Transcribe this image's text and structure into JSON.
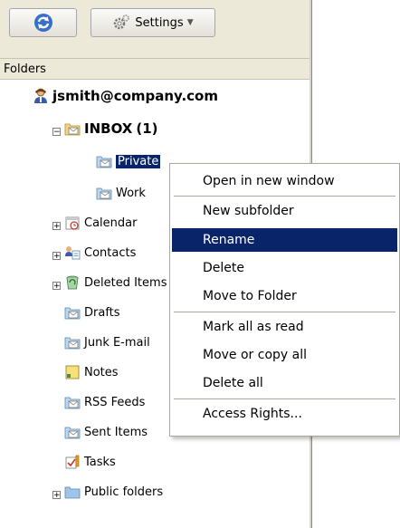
{
  "toolbar": {
    "refresh_icon": "refresh-icon",
    "settings_icon": "gear-icon",
    "settings_label": "Settings"
  },
  "folders_header": "Folders",
  "tree": {
    "account": "jsmith@company.com",
    "inbox_label": "INBOX",
    "inbox_count": "(1)",
    "items": [
      {
        "label": "Private",
        "icon": "mail-folder-icon"
      },
      {
        "label": "Work",
        "icon": "mail-folder-icon"
      },
      {
        "label": "Calendar",
        "icon": "calendar-icon"
      },
      {
        "label": "Contacts",
        "icon": "contacts-icon"
      },
      {
        "label": "Deleted Items",
        "icon": "trash-icon"
      },
      {
        "label": "Drafts",
        "icon": "mail-folder-icon"
      },
      {
        "label": "Junk E-mail",
        "icon": "mail-folder-icon"
      },
      {
        "label": "Notes",
        "icon": "notes-icon"
      },
      {
        "label": "RSS Feeds",
        "icon": "mail-folder-icon"
      },
      {
        "label": "Sent Items",
        "icon": "mail-folder-icon"
      },
      {
        "label": "Tasks",
        "icon": "tasks-icon"
      },
      {
        "label": "Public folders",
        "icon": "folder-icon"
      }
    ]
  },
  "context_menu": {
    "items": [
      "Open in new window",
      "New subfolder",
      "Rename",
      "Delete",
      "Move to Folder",
      "Mark all as read",
      "Move or copy all",
      "Delete all",
      "Access Rights..."
    ],
    "highlighted": "Rename"
  },
  "colors": {
    "selection": "#0a246a",
    "toolbar_bg": "#ece9d8",
    "folder_blue": "#9fc6e8",
    "folder_yellow": "#f5d77a"
  }
}
